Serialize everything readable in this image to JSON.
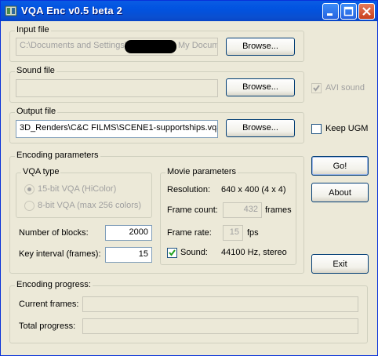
{
  "window": {
    "title": "VQA Enc v0.5 beta 2"
  },
  "input_file": {
    "group_label": "Input file",
    "value_start": "C:\\Documents and Settings\\",
    "value_end": "My Docum",
    "browse_label": "Browse..."
  },
  "sound_file": {
    "group_label": "Sound file",
    "value": "",
    "browse_label": "Browse...",
    "avi_sound_label": "AVI sound",
    "avi_sound_checked": true
  },
  "output_file": {
    "group_label": "Output file",
    "value": "3D_Renders\\C&C FILMS\\SCENE1-supportships.vqa",
    "browse_label": "Browse...",
    "keep_ugm_label": "Keep UGM",
    "keep_ugm_checked": false
  },
  "encoding": {
    "group_label": "Encoding parameters",
    "vqa_type_label": "VQA type",
    "option_15bit": "15-bit VQA (HiColor)",
    "option_8bit": "8-bit VQA (max 256 colors)",
    "selected": "15-bit",
    "blocks_label": "Number of blocks:",
    "blocks_value": "2000",
    "key_interval_label": "Key interval (frames):",
    "key_interval_value": "15"
  },
  "movie": {
    "group_label": "Movie parameters",
    "resolution_label": "Resolution:",
    "resolution_value": "640 x 400 (4 x 4)",
    "frame_count_label": "Frame count:",
    "frame_count_value": "432",
    "frame_count_unit": "frames",
    "frame_rate_label": "Frame rate:",
    "frame_rate_value": "15",
    "frame_rate_unit": "fps",
    "sound_label": "Sound:",
    "sound_checked": true,
    "sound_value": "44100 Hz, stereo"
  },
  "buttons": {
    "go": "Go!",
    "about": "About",
    "exit": "Exit"
  },
  "progress": {
    "group_label": "Encoding progress:",
    "current_label": "Current frames:",
    "current_fraction": 0,
    "total_label": "Total progress:",
    "total_fraction": 0
  },
  "colors": {
    "titlebar": "#0a5ce4",
    "face": "#ece9d8",
    "border": "#7f9db9"
  }
}
